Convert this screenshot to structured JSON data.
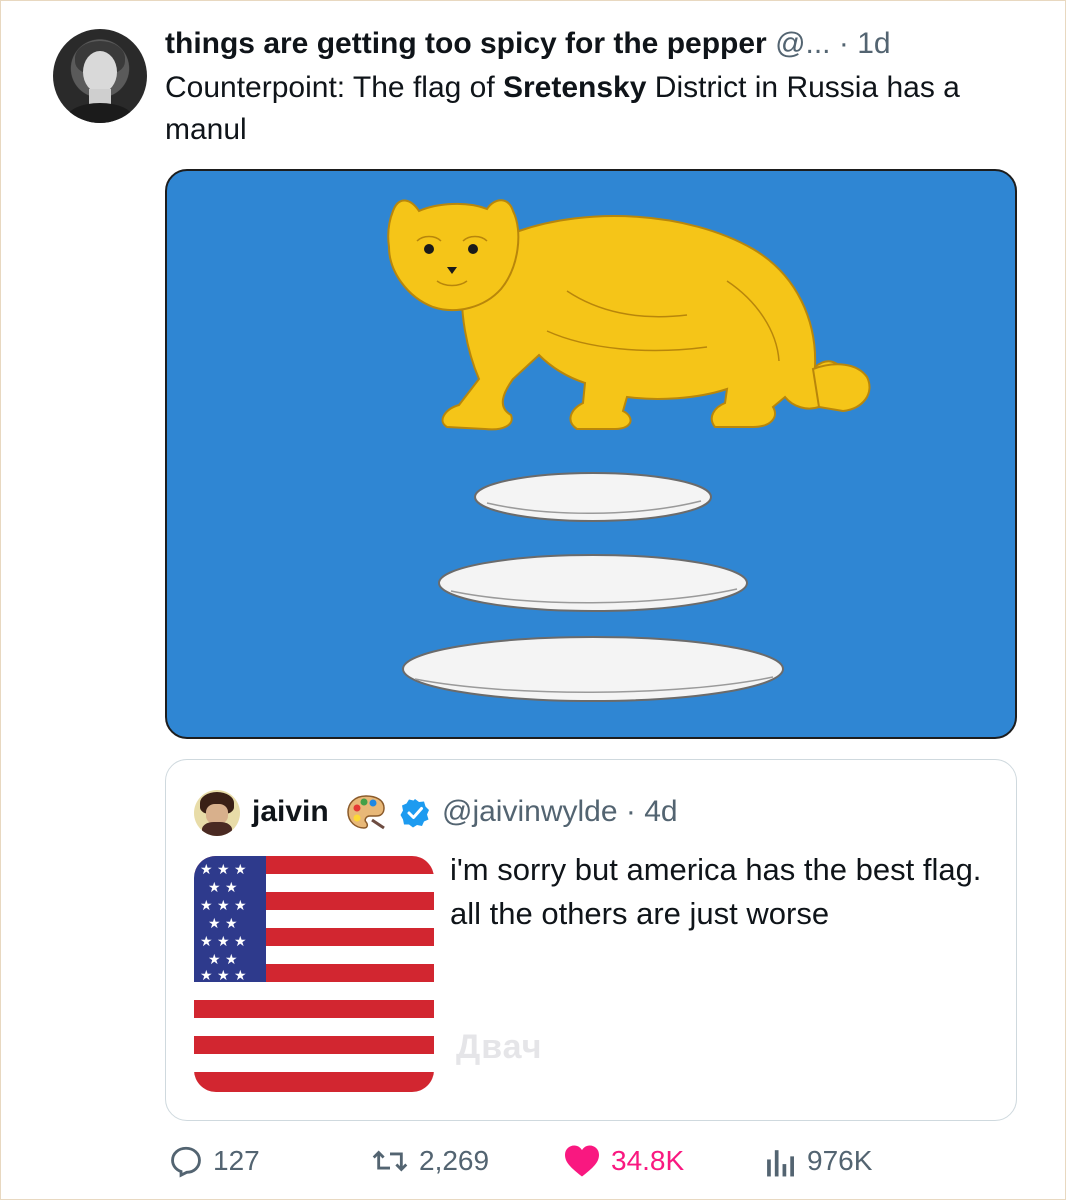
{
  "post": {
    "display_name": "things are getting too spicy for the pepper",
    "handle_truncated": "@...",
    "separator": "·",
    "time": "1d",
    "text_before": "Counterpoint: The flag of ",
    "text_bold": "Sretensky",
    "text_after": " District in Russia has a manul"
  },
  "flag": {
    "background_color": "#2f86d3",
    "animal_color": "#f5c518",
    "disc_color": "#f4f4f4",
    "icon": "manul-on-stones"
  },
  "quote": {
    "display_name": "jaivin",
    "name_emoji": "artist-palette-icon",
    "verified": true,
    "handle": "@jaivinwylde",
    "separator": "·",
    "time": "4d",
    "text": "i'm sorry but america has the best flag. all the others are just worse",
    "watermark": "Двач"
  },
  "actions": {
    "replies": "127",
    "reposts": "2,269",
    "likes": "34.8K",
    "views": "976K"
  },
  "colors": {
    "text": "#0f1419",
    "muted": "#536471",
    "like": "#f91880",
    "border": "#cfd9de"
  }
}
